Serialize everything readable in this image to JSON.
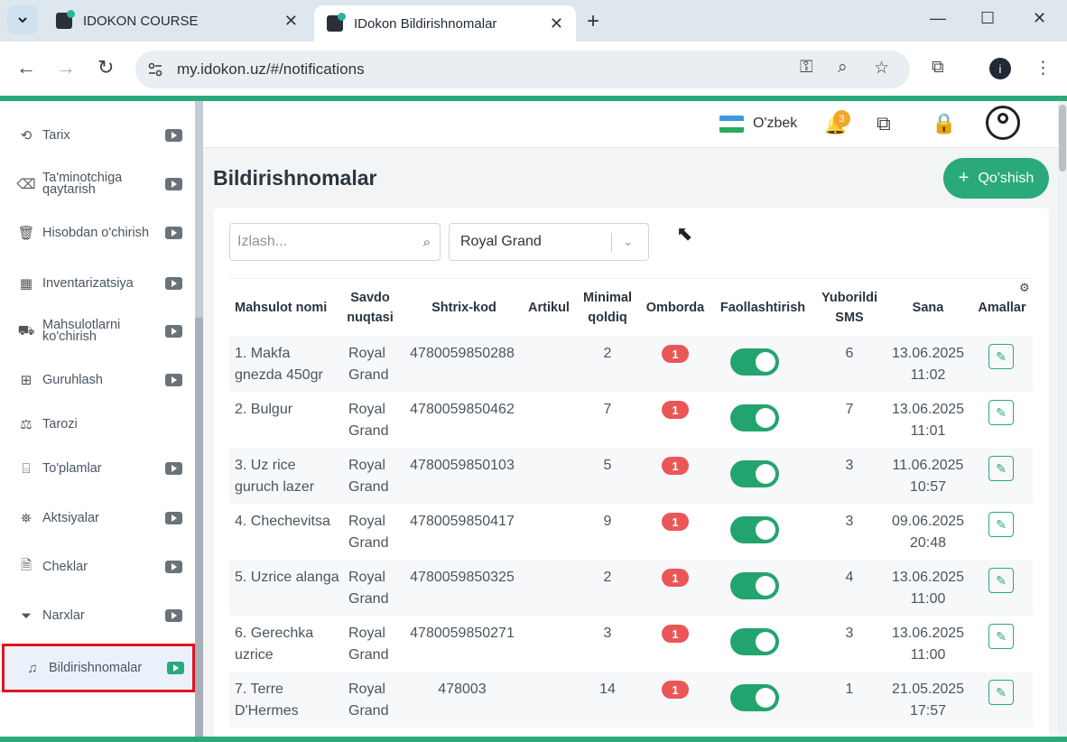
{
  "browser": {
    "tabs": [
      {
        "title": "IDOKON COURSE"
      },
      {
        "title": "IDokon Bildirishnomalar"
      }
    ],
    "url": "my.idokon.uz/#/notifications"
  },
  "sidebar": {
    "items": [
      {
        "label": "Tarix"
      },
      {
        "label": "Ta'minotchiga qaytarish"
      },
      {
        "label": "Hisobdan o'chirish"
      },
      {
        "label": "Inventarizatsiya"
      },
      {
        "label": "Mahsulotlarni ko'chirish"
      },
      {
        "label": "Guruhlash"
      },
      {
        "label": "Tarozi"
      },
      {
        "label": "To'plamlar"
      },
      {
        "label": "Aktsiyalar"
      },
      {
        "label": "Cheklar"
      },
      {
        "label": "Narxlar"
      },
      {
        "label": "Bildirishnomalar"
      }
    ]
  },
  "header": {
    "language": "O'zbek",
    "notification_count": "3"
  },
  "page": {
    "title": "Bildirishnomalar",
    "add_button": "Qo'shish",
    "search_placeholder": "Izlash...",
    "store_select": "Royal Grand"
  },
  "table": {
    "headers": {
      "name": "Mahsulot nomi",
      "store": "Savdo nuqtasi",
      "barcode": "Shtrix-kod",
      "article": "Artikul",
      "minimal": "Minimal qoldiq",
      "stock": "Omborda",
      "active": "Faollashtirish",
      "sms": "Yuborildi SMS",
      "date": "Sana",
      "actions": "Amallar"
    },
    "rows": [
      {
        "name": "1. Makfa gnezda 450gr",
        "store": "Royal Grand",
        "barcode": "4780059850288",
        "article": "",
        "minimal": "2",
        "stock": "1",
        "active": true,
        "sms": "6",
        "date": "13.06.2025 11:02"
      },
      {
        "name": "2. Bulgur",
        "store": "Royal Grand",
        "barcode": "4780059850462",
        "article": "",
        "minimal": "7",
        "stock": "1",
        "active": true,
        "sms": "7",
        "date": "13.06.2025 11:01"
      },
      {
        "name": "3. Uz rice guruch lazer",
        "store": "Royal Grand",
        "barcode": "4780059850103",
        "article": "",
        "minimal": "5",
        "stock": "1",
        "active": true,
        "sms": "3",
        "date": "11.06.2025 10:57"
      },
      {
        "name": "4. Chechevitsa",
        "store": "Royal Grand",
        "barcode": "4780059850417",
        "article": "",
        "minimal": "9",
        "stock": "1",
        "active": true,
        "sms": "3",
        "date": "09.06.2025 20:48"
      },
      {
        "name": "5. Uzrice alanga",
        "store": "Royal Grand",
        "barcode": "4780059850325",
        "article": "",
        "minimal": "2",
        "stock": "1",
        "active": true,
        "sms": "4",
        "date": "13.06.2025 11:00"
      },
      {
        "name": "6. Gerechka uzrice",
        "store": "Royal Grand",
        "barcode": "4780059850271",
        "article": "",
        "minimal": "3",
        "stock": "1",
        "active": true,
        "sms": "3",
        "date": "13.06.2025 11:00"
      },
      {
        "name": "7. Terre D'Hermes",
        "store": "Royal Grand",
        "barcode": "478003",
        "article": "",
        "minimal": "14",
        "stock": "1",
        "active": true,
        "sms": "1",
        "date": "21.05.2025 17:57"
      }
    ]
  },
  "colors": {
    "accent": "#2aaa7b",
    "badge": "#eb5757",
    "highlight_border": "#e0141f"
  }
}
